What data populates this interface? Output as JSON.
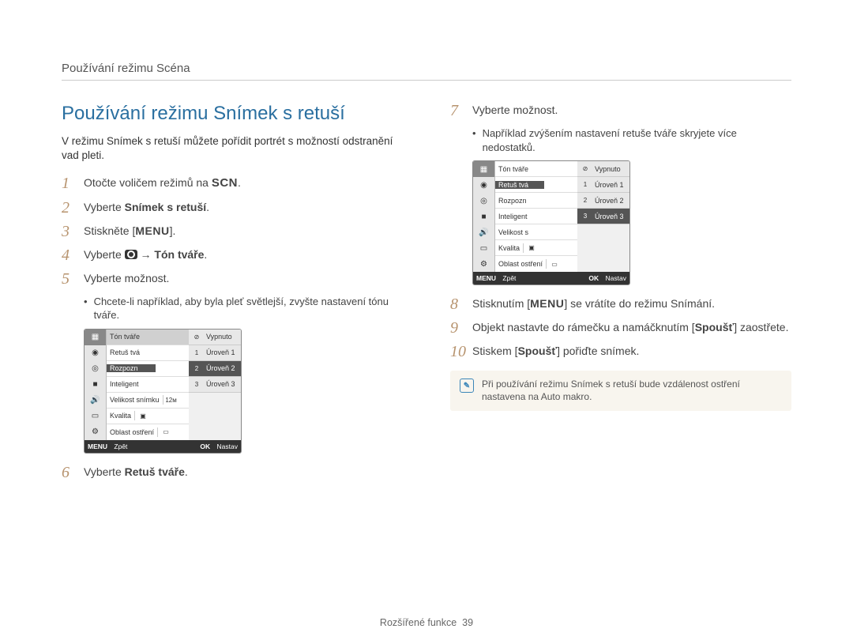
{
  "header": {
    "title": "Používání režimu Scéna"
  },
  "left": {
    "heading": "Používání režimu Snímek s retuší",
    "intro": "V režimu Snímek s retuší můžete pořídit portrét s možností odstranění vad pleti.",
    "steps": {
      "s1": {
        "num": "1",
        "text_a": "Otočte voličem režimů na ",
        "scn": "SCN",
        "text_b": "."
      },
      "s2": {
        "num": "2",
        "text_a": "Vyberte ",
        "bold": "Snímek s retuší",
        "text_b": "."
      },
      "s3": {
        "num": "3",
        "text_a": "Stiskněte [",
        "menu": "MENU",
        "text_b": "]."
      },
      "s4": {
        "num": "4",
        "text_a": "Vyberte ",
        "arrow": " → ",
        "bold": "Tón tváře",
        "text_b": "."
      },
      "s5": {
        "num": "5",
        "text": "Vyberte možnost."
      },
      "bullet5": "Chcete-li například, aby byla pleť světlejší, zvyšte nastavení tónu tváře.",
      "s6": {
        "num": "6",
        "text_a": "Vyberte ",
        "bold": "Retuš tváře",
        "text_b": "."
      }
    }
  },
  "right": {
    "steps": {
      "s7": {
        "num": "7",
        "text": "Vyberte možnost."
      },
      "bullet7": "Například zvýšením nastavení retuše tváře skryjete více nedostatků.",
      "s8": {
        "num": "8",
        "text_a": "Stisknutím [",
        "menu": "MENU",
        "text_b": "] se vrátíte do režimu Snímání."
      },
      "s9": {
        "num": "9",
        "text_a": "Objekt nastavte do rámečku a namáčknutím [",
        "bold": "Spoušť",
        "text_b": "] zaostřete."
      },
      "s10": {
        "num": "10",
        "text_a": "Stiskem [",
        "bold": "Spoušť",
        "text_b": "] pořiďte snímek."
      }
    },
    "note": "Při používání režimu Snímek s retuší bude vzdálenost ostření nastavena na Auto makro."
  },
  "cammenu": {
    "rows": {
      "r1": "Tón tváře",
      "r2": "Retuš tvá",
      "r3": "Rozpozn",
      "r4": "Inteligent",
      "r5": "Velikost snímku",
      "r6": "Kvalita",
      "r7": "Oblast ostření"
    },
    "opts": {
      "o0": "Vypnuto",
      "o1": "Úroveň 1",
      "o2": "Úroveň 2",
      "o3": "Úroveň 3"
    },
    "footer": {
      "back": "Zpět",
      "set": "Nastav",
      "menu": "MENU",
      "ok": "OK"
    },
    "right_r5": "Velikost s"
  },
  "footer": {
    "section": "Rozšířené funkce",
    "page": "39"
  }
}
